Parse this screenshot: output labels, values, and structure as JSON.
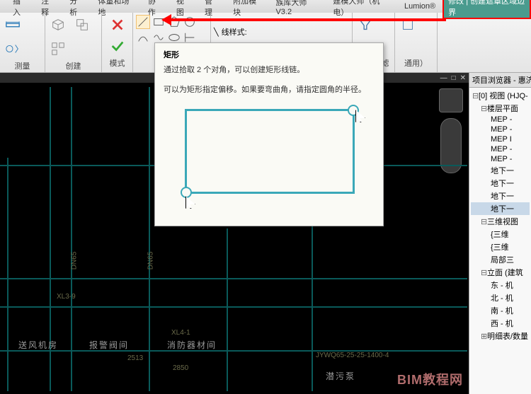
{
  "menu": [
    "插入",
    "注释",
    "分析",
    "体量和场地",
    "协作",
    "视图",
    "管理",
    "附加模块",
    "族库大师V3.2",
    "建模大师（机电）",
    "Lumion®"
  ],
  "menu_hl": "修改 | 创建遮罩区域边界",
  "ribbon": {
    "g1": "测量",
    "g2": "创建",
    "g3": "模式",
    "g4": "线样式:",
    "g5": "高级过滤",
    "g6": "通用）"
  },
  "tooltip": {
    "title": "矩形",
    "line1": "通过拾取 2 个对角，可以创建矩形线链。",
    "line2": "可以为矩形指定偏移。如果要弯曲角，请指定圆角的半径。"
  },
  "browser": {
    "title": "项目浏览器 - 惠济区",
    "root": "[0] 视图 (HJQ-",
    "floors": "楼层平面",
    "mep": [
      "MEP -",
      "MEP -",
      "MEP I",
      "MEP -",
      "MEP -"
    ],
    "dx": [
      "地下一",
      "地下一",
      "地下一",
      "地下一"
    ],
    "view3d": "三维视图",
    "v3": [
      "{三维",
      "{三维"
    ],
    "local": "局部三",
    "elev": "立面 (建筑",
    "dirs": [
      "东 - 机",
      "北 - 机",
      "南 - 机",
      "西 - 机"
    ],
    "schedule": "明细表/数量"
  },
  "rooms": {
    "r1": "送风机房",
    "r2": "报警阀间",
    "r3": "消防器材间",
    "r4": "潜污泵"
  },
  "dims": {
    "d1": "2513",
    "d2": "2850"
  },
  "pipe": {
    "p1": "DN65",
    "p2": "DN65"
  },
  "tags": {
    "t1": "XL3-9",
    "t2": "XL4-1",
    "t3": "JYWQ65-25-25-1400-4"
  },
  "watermark": "BIM教程网"
}
